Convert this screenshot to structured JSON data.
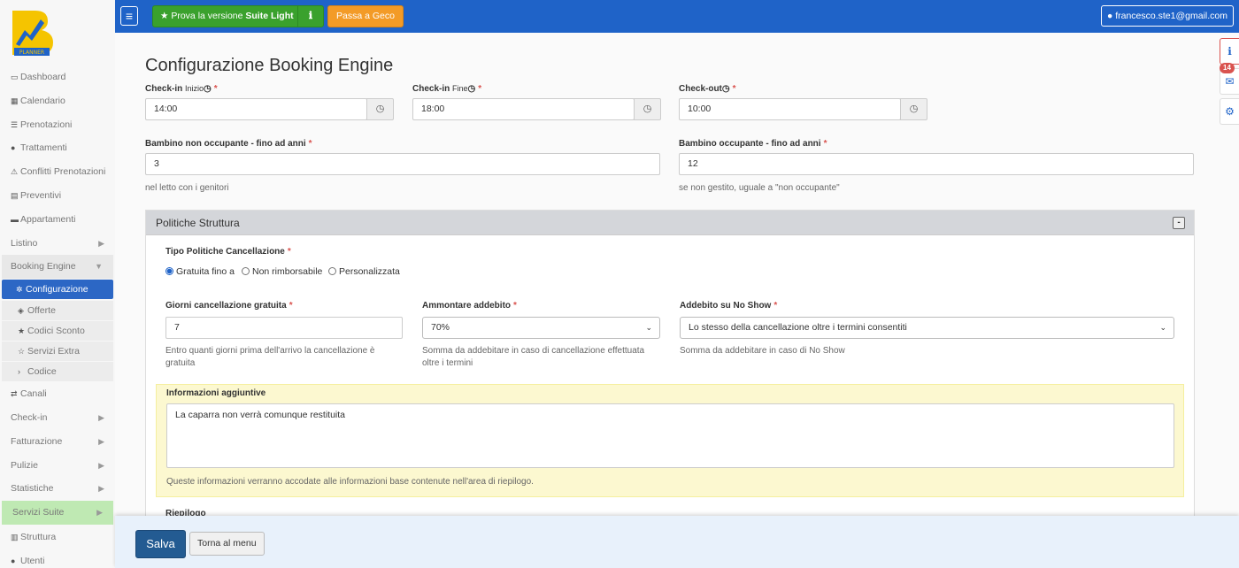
{
  "app": {
    "logo_text": "PLANNER"
  },
  "topbar": {
    "menu_icon": "hamburger-icon",
    "trial_prefix": "Prova la versione",
    "trial_bold": "Suite Light",
    "geco_label": "Passa a Geco",
    "user_email": "francesco.ste1@gmail.com"
  },
  "sidebar": {
    "items": [
      {
        "label": "Dashboard",
        "icon": "dashboard-icon"
      },
      {
        "label": "Calendario",
        "icon": "calendar-icon"
      },
      {
        "label": "Prenotazioni",
        "icon": "list-icon"
      },
      {
        "label": "Trattamenti",
        "icon": "apple-icon"
      },
      {
        "label": "Conflitti Prenotazioni",
        "icon": "warning-icon"
      },
      {
        "label": "Preventivi",
        "icon": "calculator-icon"
      },
      {
        "label": "Appartamenti",
        "icon": "bed-icon"
      },
      {
        "label": "Listino"
      },
      {
        "label": "Booking Engine"
      },
      {
        "label": "Configurazione",
        "icon": "gear-icon"
      },
      {
        "label": "Offerte",
        "icon": "tags-icon"
      },
      {
        "label": "Codici Sconto",
        "icon": "star-icon"
      },
      {
        "label": "Servizi Extra",
        "icon": "star-outline-icon"
      },
      {
        "label": "Codice",
        "icon": "terminal-icon"
      },
      {
        "label": "Canali",
        "icon": "random-icon"
      },
      {
        "label": "Check-in"
      },
      {
        "label": "Fatturazione"
      },
      {
        "label": "Pulizie"
      },
      {
        "label": "Statistiche"
      },
      {
        "label": "Servizi Suite"
      },
      {
        "label": "Struttura",
        "icon": "building-icon"
      },
      {
        "label": "Utenti",
        "icon": "user-icon"
      }
    ]
  },
  "right_tools": {
    "mail_badge": "14"
  },
  "page": {
    "title": "Configurazione Booking Engine",
    "checkin_start": {
      "label": "Check-in",
      "sub": "Inizio",
      "value": "14:00"
    },
    "checkin_end": {
      "label": "Check-in",
      "sub": "Fine",
      "value": "18:00"
    },
    "checkout": {
      "label": "Check-out",
      "value": "10:00"
    },
    "child_nonocc": {
      "label": "Bambino non occupante - fino ad anni",
      "value": "3",
      "help": "nel letto con i genitori"
    },
    "child_occ": {
      "label": "Bambino occupante - fino ad anni",
      "value": "12",
      "help": "se non gestito, uguale a \"non occupante\""
    }
  },
  "policies": {
    "title": "Politiche Struttura",
    "collapse": "-",
    "type_label": "Tipo Politiche Cancellazione",
    "options": [
      "Gratuita fino a",
      "Non rimborsabile",
      "Personalizzata"
    ],
    "selected": 0,
    "free_days": {
      "label": "Giorni cancellazione gratuita",
      "value": "7",
      "help": "Entro quanti giorni prima dell'arrivo la cancellazione è gratuita"
    },
    "amount": {
      "label": "Ammontare addebito",
      "value": "70%",
      "help": "Somma da addebitare in caso di cancellazione effettuata oltre i termini"
    },
    "noshow": {
      "label": "Addebito su No Show",
      "value": "Lo stesso della cancellazione oltre i termini consentiti",
      "help": "Somma da addebitare in caso di No Show"
    },
    "info_label": "Informazioni aggiuntive",
    "info_value": "La caparra non verrà comunque restituita",
    "info_help": "Queste informazioni verranno accodate alle informazioni base contenute nell'area di riepilogo.",
    "summary_label": "Riepilogo"
  },
  "footer": {
    "save_label": "Salva",
    "back_label": "Torna al menu"
  }
}
